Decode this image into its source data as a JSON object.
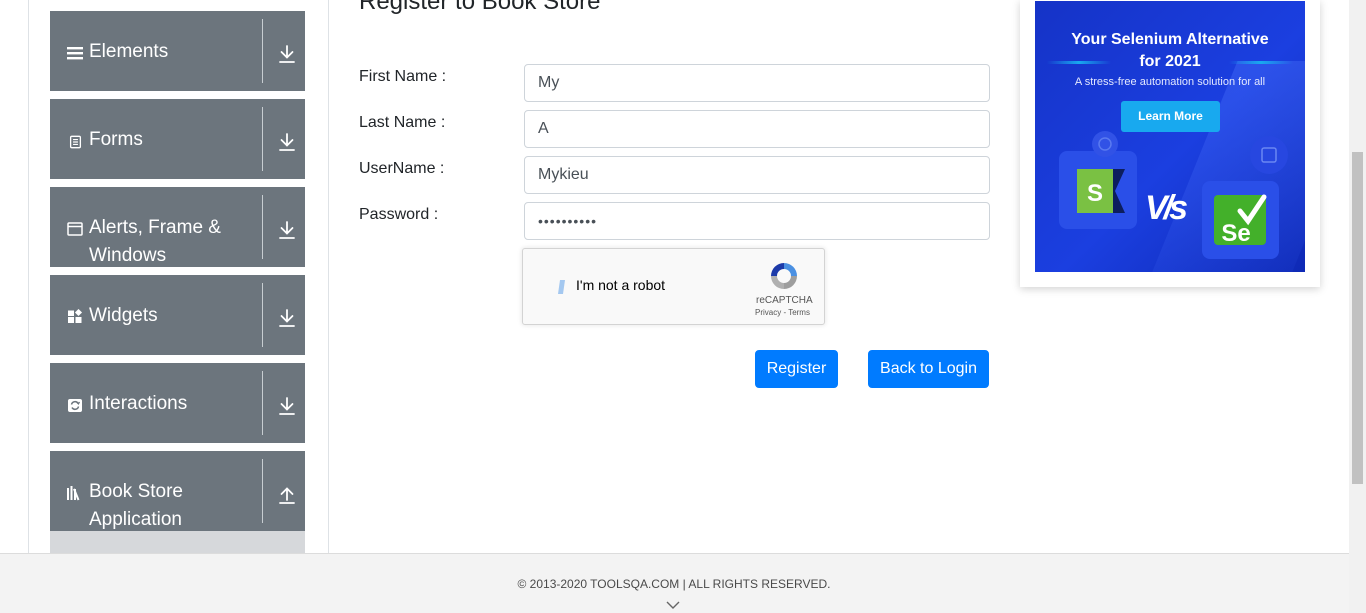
{
  "sidebar": {
    "groups": [
      {
        "label": "Elements",
        "icon": "hamburger-icon",
        "arrow": "download-arrow-icon"
      },
      {
        "label": "Forms",
        "icon": "document-icon",
        "arrow": "download-arrow-icon"
      },
      {
        "label": "Alerts, Frame & Windows",
        "icon": "window-icon",
        "arrow": "download-arrow-icon"
      },
      {
        "label": "Widgets",
        "icon": "widgets-icon",
        "arrow": "download-arrow-icon"
      },
      {
        "label": "Interactions",
        "icon": "interactions-icon",
        "arrow": "download-arrow-icon"
      },
      {
        "label": "Book Store Application",
        "icon": "books-icon",
        "arrow": "upload-arrow-icon"
      }
    ]
  },
  "form": {
    "title": "Register to Book Store",
    "first_name_label": "First Name :",
    "first_name_value": "My",
    "last_name_label": "Last Name :",
    "last_name_value": "A",
    "username_label": "UserName :",
    "username_value": "Mykieu",
    "password_label": "Password :",
    "password_value": "••••••••••",
    "captcha": {
      "text": "I'm not a robot",
      "brand": "reCAPTCHA",
      "links": "Privacy - Terms"
    },
    "register_label": "Register",
    "back_label": "Back to Login"
  },
  "ad": {
    "headline": "Your Selenium Alternative for 2021",
    "subtext": "A stress-free automation solution for all",
    "cta": "Learn More",
    "vs": "V/s",
    "left_logo": "S",
    "right_logo": "Se"
  },
  "footer": {
    "copyright": "© 2013-2020 TOOLSQA.COM | ALL RIGHTS RESERVED."
  },
  "colors": {
    "sidebar_bg": "#6c757d",
    "primary": "#007bff",
    "ad_bg": "#1b3fe0",
    "ad_cta": "#18a9ef"
  }
}
